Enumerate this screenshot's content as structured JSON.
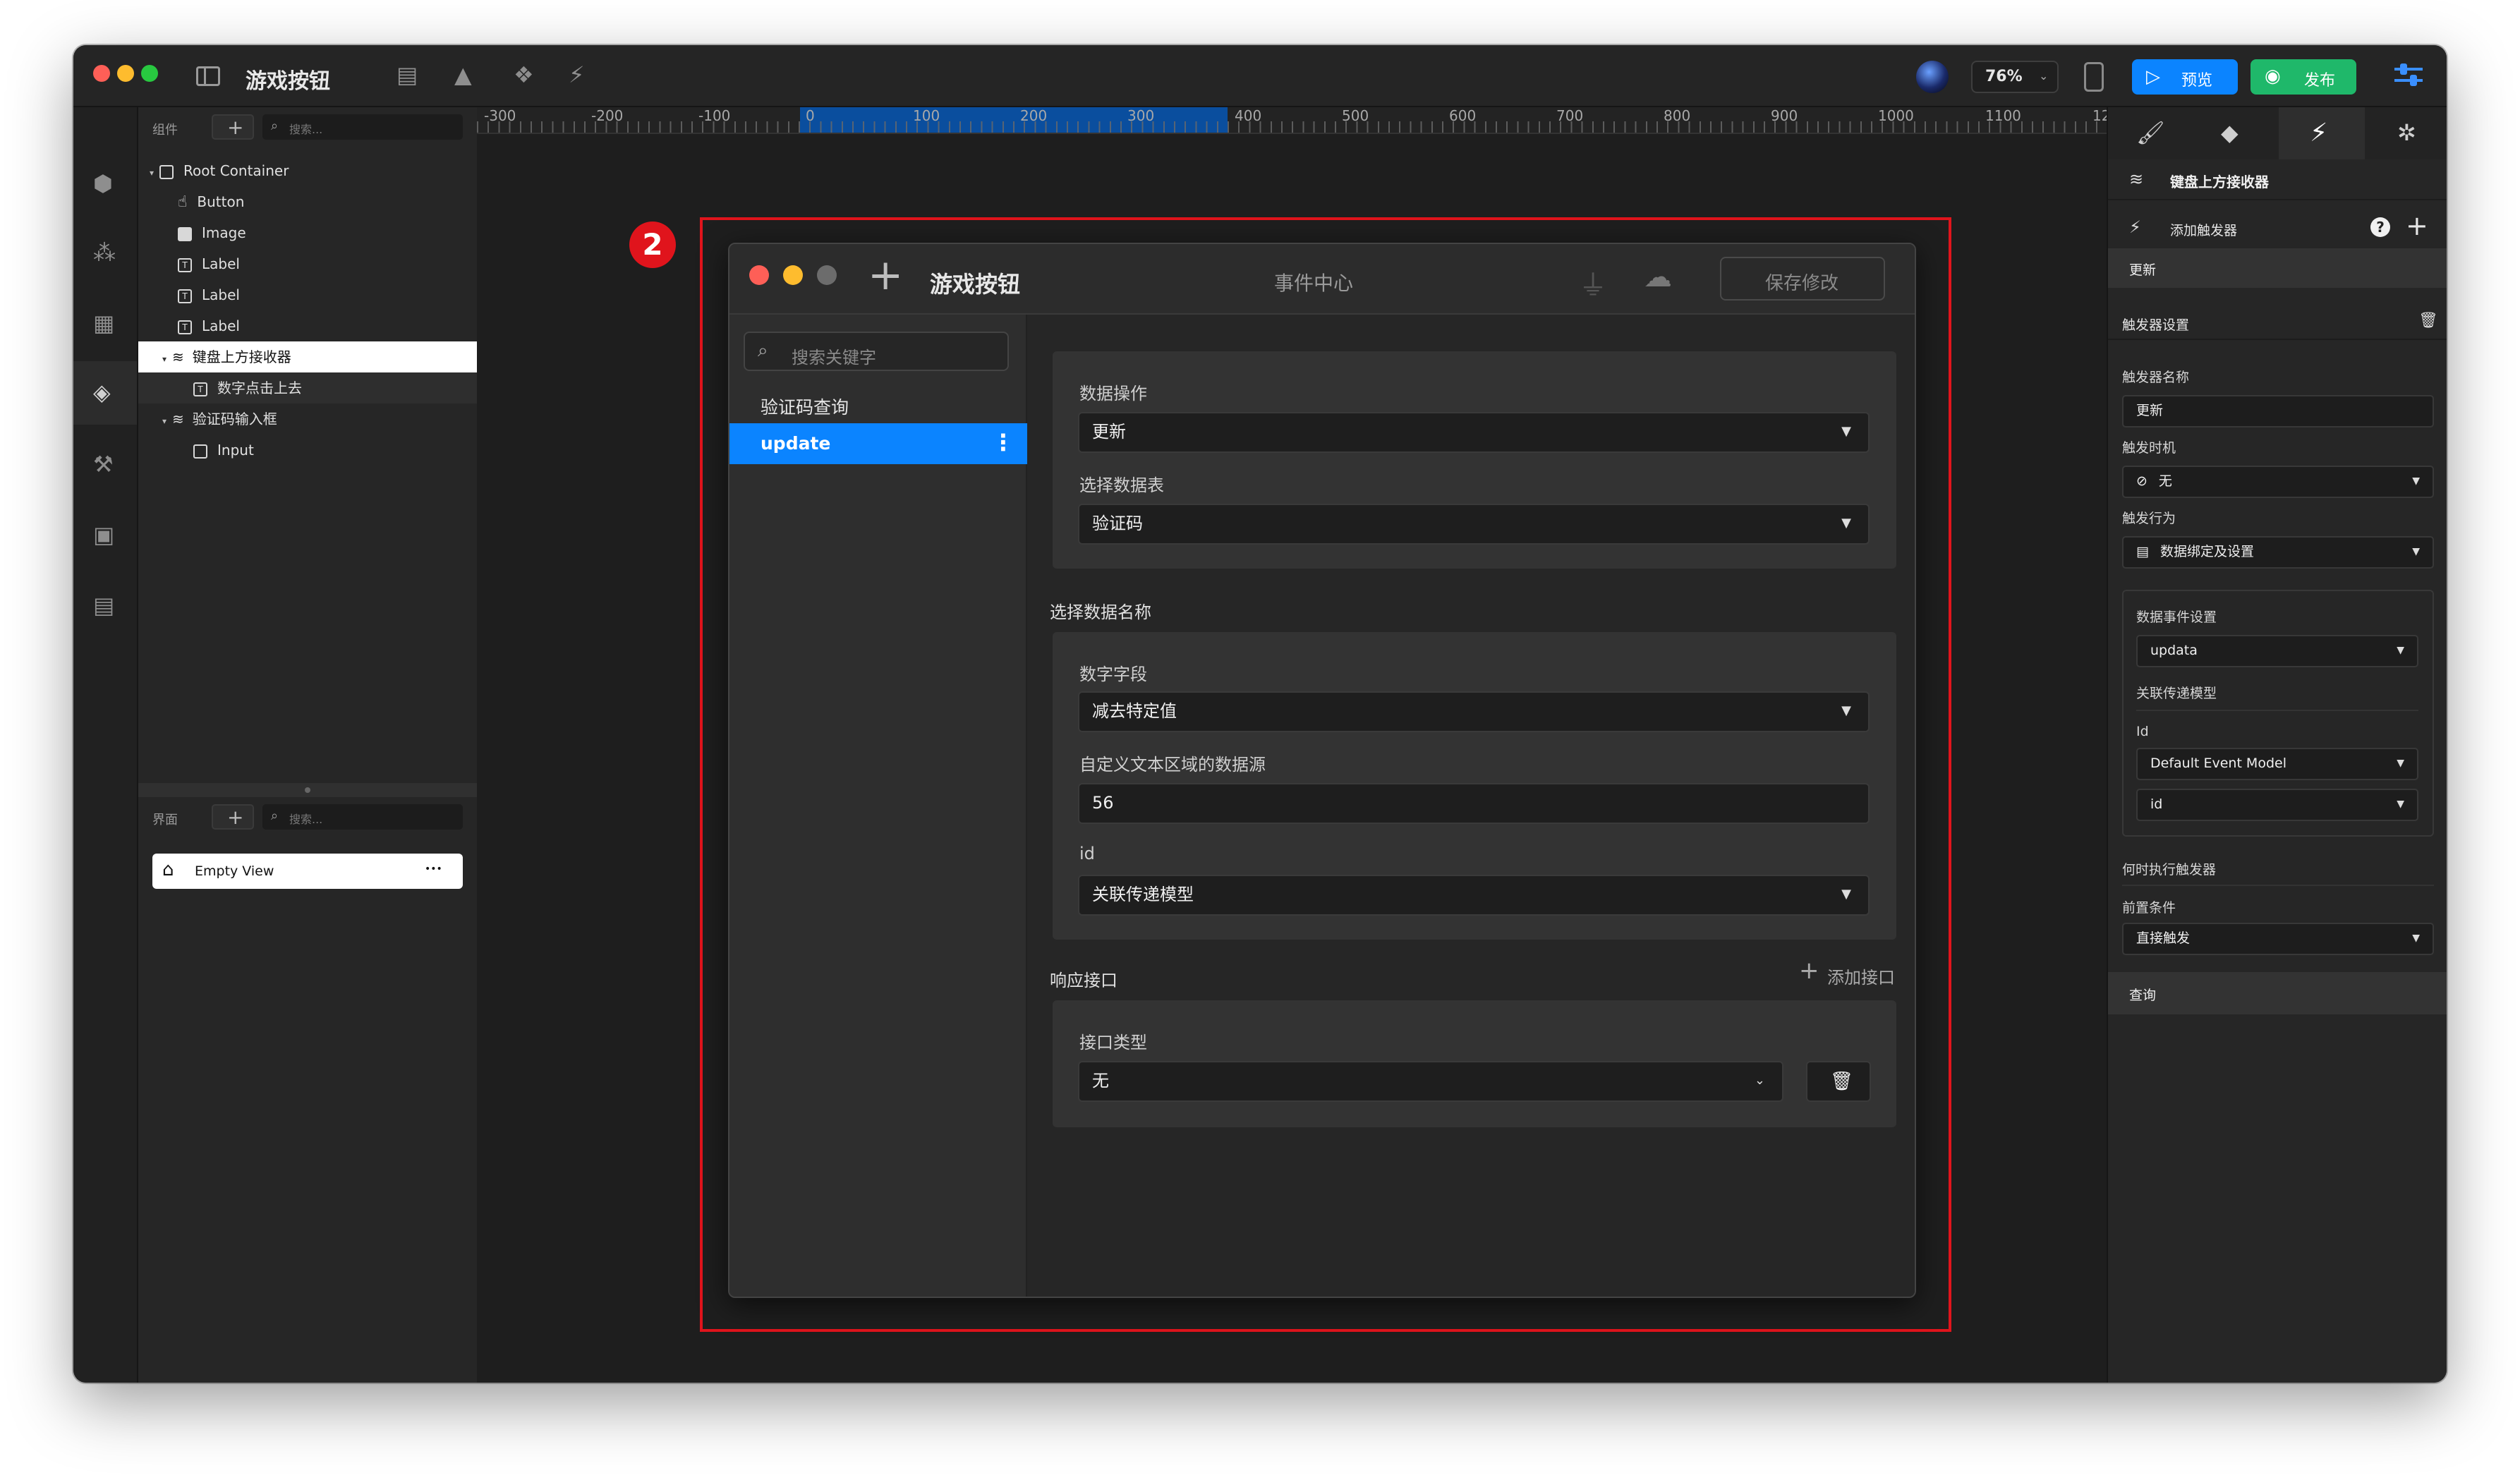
{
  "app": {
    "title": "游戏按钮",
    "zoom": "76%",
    "preview_label": "预览",
    "publish_label": "发布",
    "colors": {
      "accent": "#0b84ff",
      "publish": "#1fb86a",
      "highlight": "#e0141c"
    }
  },
  "left_panel": {
    "components_label": "组件",
    "search_placeholder": "搜索...",
    "tree": [
      {
        "label": "Root Container"
      },
      {
        "label": "Button"
      },
      {
        "label": "Image"
      },
      {
        "label": "Label"
      },
      {
        "label": "Label"
      },
      {
        "label": "Label"
      },
      {
        "label": "键盘上方接收器"
      },
      {
        "label": "数字点击上去"
      },
      {
        "label": "验证码输入框"
      },
      {
        "label": "Input"
      }
    ],
    "pages_label": "界面",
    "pages_search_placeholder": "搜索...",
    "pages": [
      {
        "label": "Empty View",
        "more": "•••"
      }
    ]
  },
  "ruler": [
    "-300",
    "-200",
    "-100",
    "0",
    "100",
    "200",
    "300",
    "400",
    "500",
    "600",
    "700",
    "800",
    "900",
    "1000",
    "1100",
    "12"
  ],
  "annotation_badge": "2",
  "dialog": {
    "title": "游戏按钮",
    "center_title": "事件中心",
    "save_label": "保存修改",
    "search_placeholder": "搜索关键字",
    "list": [
      {
        "label": "验证码查询"
      },
      {
        "label": "update",
        "more": "⋮"
      }
    ],
    "section1": {
      "data_op_label": "数据操作",
      "data_op_value": "更新",
      "table_label": "选择数据表",
      "table_value": "验证码"
    },
    "section2_title": "选择数据名称",
    "section2": {
      "num_field_label": "数字字段",
      "num_field_value": "减去特定值",
      "custom_label": "自定义文本区域的数据源",
      "custom_value": "56",
      "id_label": "id",
      "id_value": "关联传递模型"
    },
    "response_title": "响应接口",
    "add_api_label": "添加接口",
    "section3": {
      "api_type_label": "接口类型",
      "api_type_value": "无"
    }
  },
  "right_panel": {
    "component_name": "键盘上方接收器",
    "add_trigger_label": "添加触发器",
    "trigger_item": "更新",
    "settings_title": "触发器设置",
    "name_label": "触发器名称",
    "name_value": "更新",
    "timing_label": "触发时机",
    "timing_value": "无",
    "action_label": "触发行为",
    "action_value": "数据绑定及设置",
    "data_event_label": "数据事件设置",
    "data_event_value": "updata",
    "model_label": "关联传递模型",
    "id_label": "Id",
    "model_value": "Default Event Model",
    "id_value": "id",
    "when_label": "何时执行触发器",
    "precondition_label": "前置条件",
    "precondition_value": "直接触发",
    "query_item": "查询"
  }
}
